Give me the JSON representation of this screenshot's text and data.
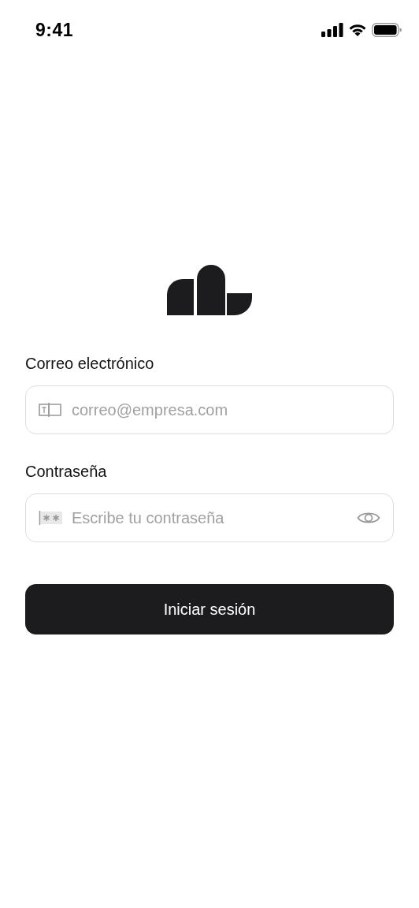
{
  "status_bar": {
    "time": "9:41"
  },
  "fields": [
    {
      "kind": "email",
      "label": "Correo electrónico",
      "placeholder": "correo@empresa.com"
    },
    {
      "kind": "password",
      "label": "Contraseña",
      "placeholder": "Escribe tu contraseña"
    }
  ],
  "submit_button": {
    "label": "Iniciar sesión"
  }
}
